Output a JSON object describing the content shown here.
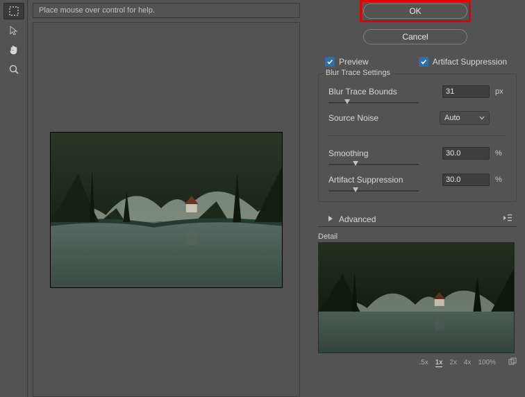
{
  "help_text": "Place mouse over control for help.",
  "buttons": {
    "ok": "OK",
    "cancel": "Cancel"
  },
  "preview_checkbox": "Preview",
  "artifact_checkbox": "Artifact Suppression",
  "blur_trace_section": {
    "title": "Blur Trace Settings",
    "bounds_label": "Blur Trace Bounds",
    "bounds_value": "31",
    "bounds_unit": "px",
    "noise_label": "Source Noise",
    "noise_value": "Auto",
    "smoothing_label": "Smoothing",
    "smoothing_value": "30.0",
    "smoothing_unit": "%",
    "artifact_label": "Artifact Suppression",
    "artifact_value": "30.0",
    "artifact_unit": "%"
  },
  "advanced_label": "Advanced",
  "detail_label": "Detail",
  "zoom_levels": {
    "z05": ".5x",
    "z1": "1x",
    "z2": "2x",
    "z4": "4x",
    "z100": "100%"
  }
}
